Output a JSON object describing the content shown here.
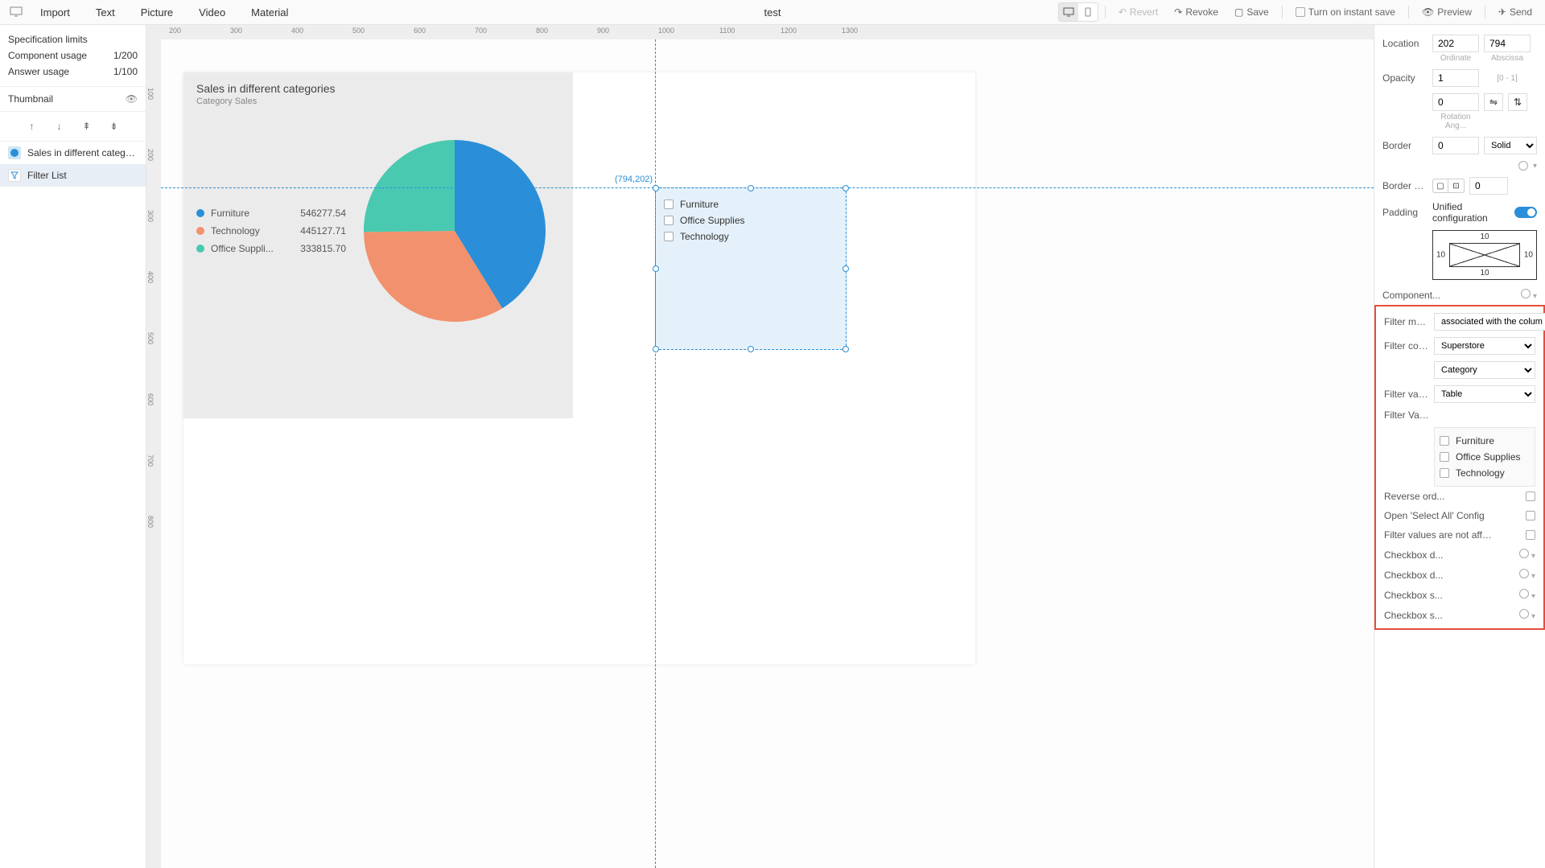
{
  "toolbar": {
    "menus": [
      "Import",
      "Text",
      "Picture",
      "Video",
      "Material"
    ],
    "title": "test",
    "revert": "Revert",
    "revoke": "Revoke",
    "save": "Save",
    "instant": "Turn on instant save",
    "preview": "Preview",
    "send": "Send"
  },
  "left": {
    "spec_limits": "Specification limits",
    "comp_usage_label": "Component usage",
    "comp_usage_val": "1/200",
    "ans_usage_label": "Answer usage",
    "ans_usage_val": "1/100",
    "thumbnail": "Thumbnail",
    "layers": [
      {
        "label": "Sales in different catego...",
        "color": "#2a8fd8"
      },
      {
        "label": "Filter List",
        "color": "#7db8e0"
      }
    ]
  },
  "ruler_h": [
    "200",
    "300",
    "400",
    "500",
    "600",
    "700",
    "800",
    "900",
    "1000",
    "1100",
    "1200",
    "1300"
  ],
  "ruler_v": [
    "100",
    "200",
    "300",
    "400",
    "500",
    "600",
    "700",
    "800"
  ],
  "chart_data": {
    "type": "pie",
    "title": "Sales in different categories",
    "subtitle": "Category Sales",
    "series": [
      {
        "name": "Furniture",
        "value": 546277.54,
        "color": "#2a8fd8"
      },
      {
        "name": "Technology",
        "value": 445127.71,
        "color": "#f2916d"
      },
      {
        "name": "Office Suppli...",
        "value": 333815.7,
        "color": "#48c9b0"
      }
    ]
  },
  "filter_comp": {
    "coord": "(794,202)",
    "items": [
      "Furniture",
      "Office Supplies",
      "Technology"
    ]
  },
  "props": {
    "location": "Location",
    "ordinate": "202",
    "abscissa": "794",
    "ordinate_lbl": "Ordinate",
    "abscissa_lbl": "Abscissa",
    "opacity": "Opacity",
    "opacity_val": "1",
    "opacity_hint": "[0 - 1]",
    "rotation_val": "0",
    "rotation_lbl": "Rotation Ang...",
    "border": "Border",
    "border_val": "0",
    "border_style": "Solid",
    "border_radi": "Border Radi...",
    "border_radi_val": "0",
    "padding": "Padding",
    "unified": "Unified configuration",
    "pad_top": "10",
    "pad_bottom": "10",
    "pad_left": "10",
    "pad_right": "10",
    "component": "Component...",
    "filter_mode": "Filter mode",
    "filter_mode_val": "associated with the colum",
    "filter_col": "Filter colum...",
    "filter_col_val": "Superstore",
    "filter_col_val2": "Category",
    "filter_val_label": "Filter value ...",
    "filter_val_sel": "Table",
    "filter_value": "Filter Value ...",
    "fv_items": [
      "Furniture",
      "Office Supplies",
      "Technology"
    ],
    "reverse": "Reverse ord...",
    "select_all": "Open 'Select All' Config",
    "not_affected": "Filter values are not affected by others",
    "checkbox_d1": "Checkbox d...",
    "checkbox_d2": "Checkbox d...",
    "checkbox_s1": "Checkbox s...",
    "checkbox_s2": "Checkbox s..."
  }
}
